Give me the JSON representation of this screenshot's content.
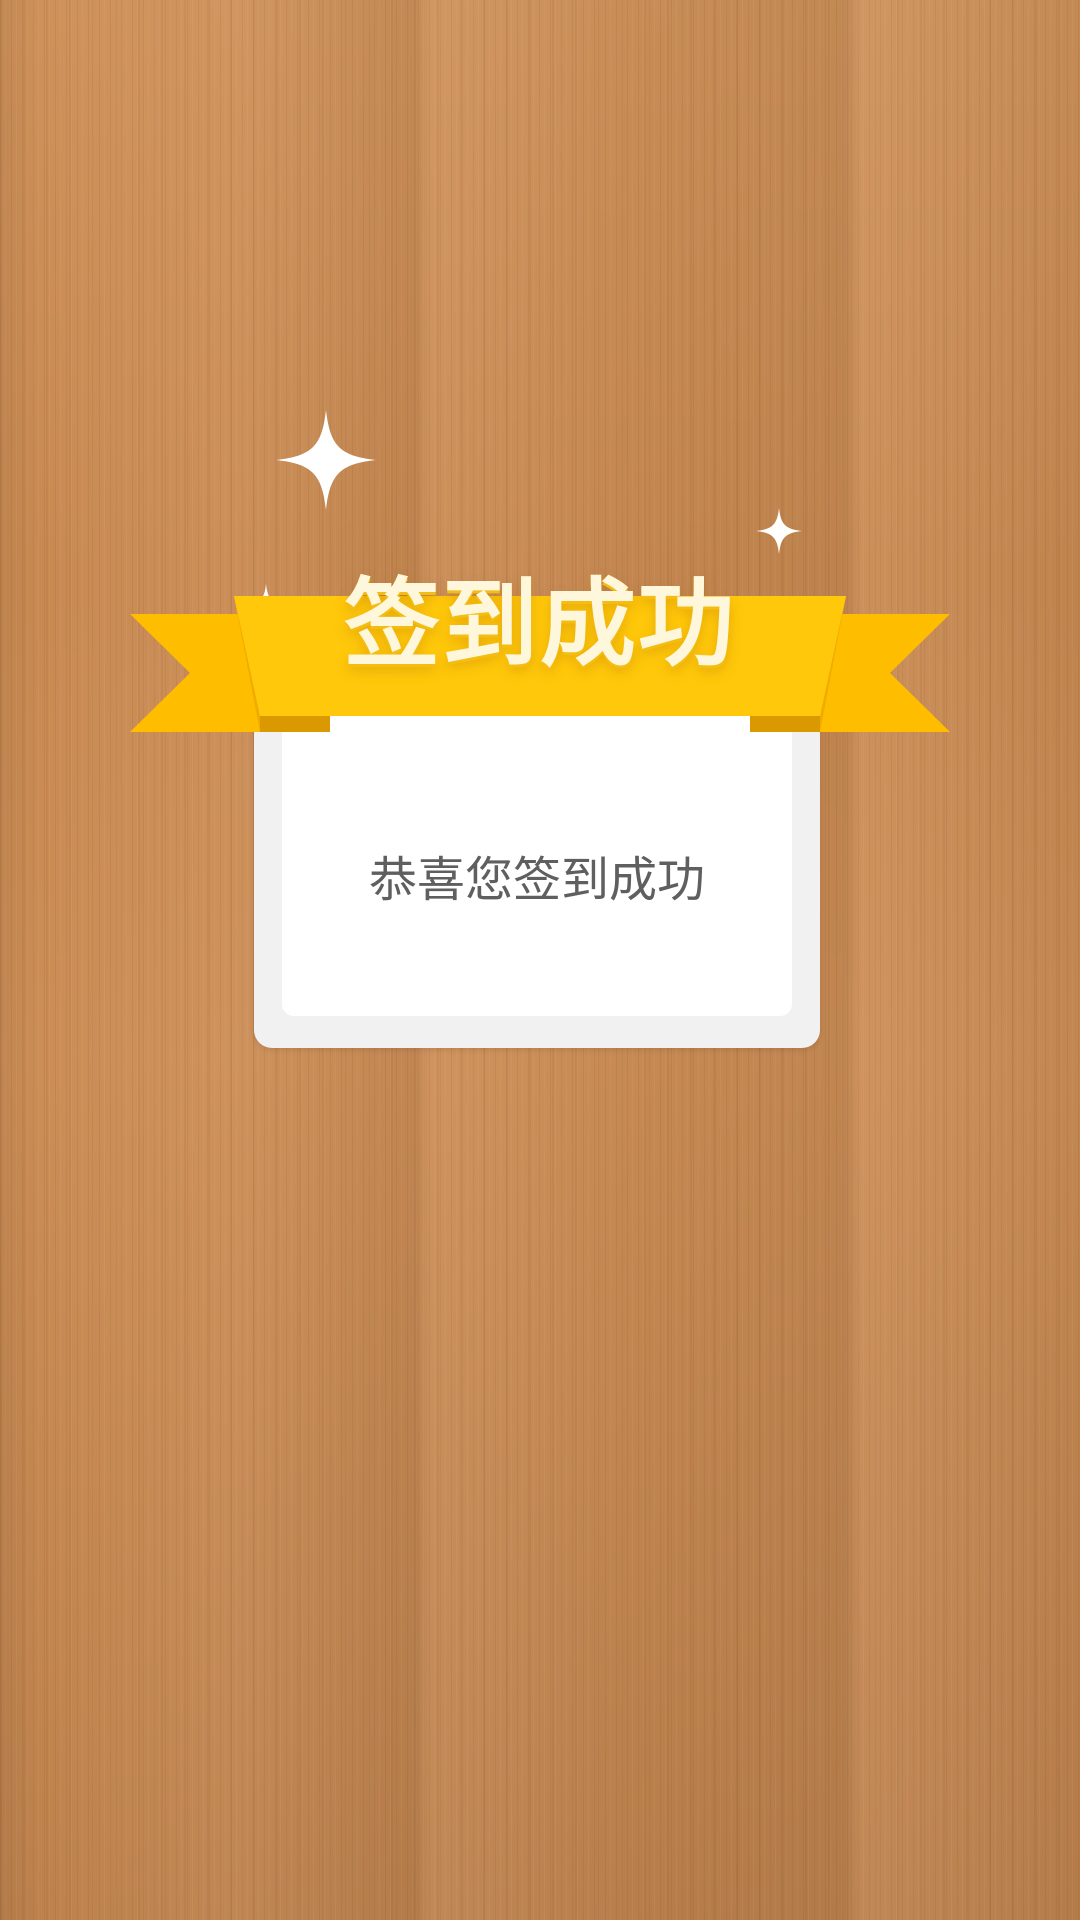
{
  "banner": {
    "title": "签到成功"
  },
  "card": {
    "message": "恭喜您签到成功"
  },
  "colors": {
    "ribbon": "#ffc200",
    "ribbon_fold": "#e2a300",
    "card_border": "#f1f1f1",
    "card_fill": "#ffffff",
    "message_text": "#5f5f5f",
    "wood": "#c98a52"
  },
  "icons": [
    "sparkle-icon"
  ]
}
